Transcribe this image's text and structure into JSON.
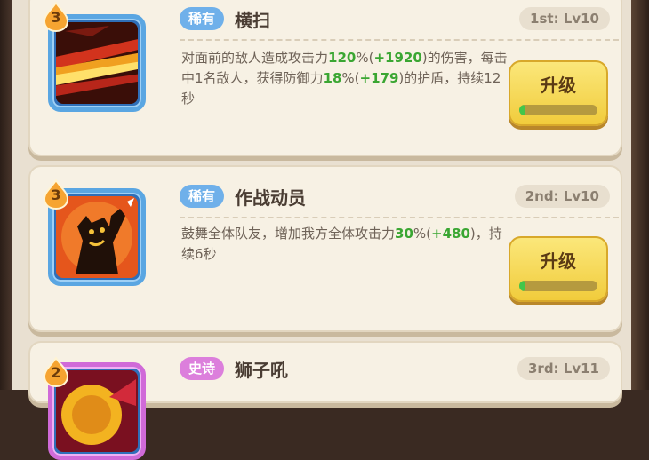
{
  "skills": [
    {
      "level": "3",
      "rarity": "稀有",
      "rarity_type": "rare",
      "name": "横扫",
      "rank": "1st: Lv10",
      "icon": "slash-fire-icon",
      "desc": [
        {
          "t": "对面前的敌人造成攻击力"
        },
        {
          "t": "120",
          "hl": true
        },
        {
          "t": "%("
        },
        {
          "t": "+1920",
          "hl": true
        },
        {
          "t": ")的伤害，每击中1名敌人，获得防御力"
        },
        {
          "t": "18",
          "hl": true
        },
        {
          "t": "%("
        },
        {
          "t": "+179",
          "hl": true
        },
        {
          "t": ")的护盾，持续12秒"
        }
      ],
      "upgrade_label": "升级",
      "progress": 0.05
    },
    {
      "level": "3",
      "rarity": "稀有",
      "rarity_type": "rare",
      "name": "作战动员",
      "rank": "2nd: Lv10",
      "icon": "rally-icon",
      "desc": [
        {
          "t": "鼓舞全体队友，增加我方全体攻击力"
        },
        {
          "t": "30",
          "hl": true
        },
        {
          "t": "%("
        },
        {
          "t": "+480",
          "hl": true
        },
        {
          "t": ")，持续6秒"
        }
      ],
      "upgrade_label": "升级",
      "progress": 0.05
    },
    {
      "level": "2",
      "rarity": "史诗",
      "rarity_type": "epic",
      "name": "狮子吼",
      "rank": "3rd: Lv11",
      "icon": "lion-roar-icon"
    }
  ],
  "colors": {
    "rare": "#6fb0ea",
    "epic": "#dc7fdc",
    "highlight": "#3aa632",
    "button": "#f1cc3c"
  }
}
